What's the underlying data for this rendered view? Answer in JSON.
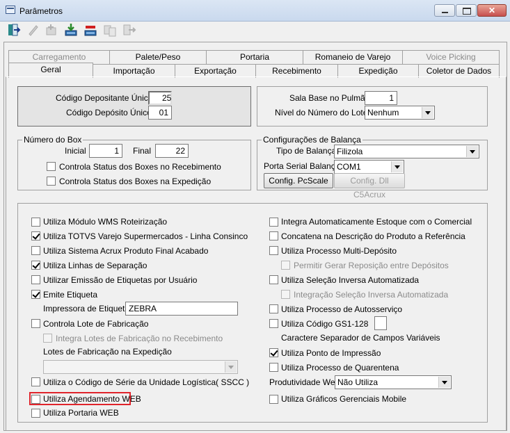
{
  "window": {
    "title": "Parâmetros",
    "close_glyph": "✕"
  },
  "toolbar": {
    "icons": [
      "exit-icon",
      "edit-icon",
      "add-icon",
      "download-icon",
      "delete-icon",
      "copy-icon",
      "export-icon"
    ]
  },
  "tabs": {
    "row1": [
      "Carregamento",
      "Palete/Peso",
      "Portaria",
      "Romaneio de Varejo",
      "Voice Picking"
    ],
    "row2": [
      "Geral",
      "Importação",
      "Exportação",
      "Recebimento",
      "Expedição",
      "Coletor de Dados"
    ]
  },
  "depositante": {
    "codigo_depositante_label": "Código Depositante Único",
    "codigo_depositante_value": "25",
    "codigo_deposito_label": "Código Depósito Único",
    "codigo_deposito_value": "01"
  },
  "sala": {
    "sala_base_label": "Sala Base no Pulmão",
    "sala_base_value": "1",
    "nivel_label": "Nível do Número do Lote",
    "nivel_value": "Nenhum"
  },
  "box": {
    "title": "Número do Box",
    "inicial_label": "Inicial",
    "inicial_value": "1",
    "final_label": "Final",
    "final_value": "22",
    "status_recebimento": "Controla Status dos Boxes no Recebimento",
    "status_expedicao": "Controla Status dos Boxes na Expedição"
  },
  "balanca": {
    "title": "Configurações de Balança",
    "tipo_label": "Tipo de Balança",
    "tipo_value": "Filizola",
    "porta_label": "Porta Serial Balança",
    "porta_value": "COM1",
    "config_pcscale": "Config. PcScale",
    "config_dll": "Config. Dll C5Acrux"
  },
  "left_options": {
    "wms": "Utiliza Módulo WMS Roteirização",
    "totvs": "Utiliza TOTVS Varejo Supermercados - Linha Consinco",
    "acrux": "Utiliza Sistema Acrux Produto Final Acabado",
    "linhas": "Utiliza Linhas de Separação",
    "emissao": "Utilizar Emissão de Etiquetas por Usuário",
    "emite": "Emite Etiqueta",
    "impressora_label": "Impressora de Etiquetas",
    "impressora_value": "ZEBRA",
    "lote_fab": "Controla Lote de Fabricação",
    "integra_lotes": "Integra  Lotes de Fabricação no Recebimento",
    "lotes_exp_label": "Lotes de Fabricação na Expedição",
    "lotes_exp_value": "",
    "sscc": "Utiliza o Código de Série da Unidade Logística( SSCC )",
    "agendamento": "Utiliza Agendamento WEB",
    "portaria": "Utiliza Portaria WEB"
  },
  "right_options": {
    "integra_estoque": "Integra Automaticamente Estoque com o Comercial",
    "concatena": "Concatena na Descrição do Produto a Referência",
    "multi_deposito": "Utiliza Processo Multi-Depósito",
    "permitir_reposicao": "Permitir Gerar Reposição entre Depósitos",
    "selecao_inversa": "Utiliza Seleção Inversa Automatizada",
    "integracao_selecao": "Integração Seleção Inversa Automatizada",
    "autosservico": "Utiliza Processo de Autosserviço",
    "gs1": "Utiliza Código GS1-128",
    "gs1_value": "",
    "separador": "Caractere Separador de Campos Variáveis",
    "ponto_impressao": "Utiliza Ponto de Impressão",
    "quarentena": "Utiliza Processo de Quarentena",
    "produtividade_label": "Produtividade Web",
    "produtividade_value": "Não Utiliza",
    "graficos": "Utiliza Gráficos Gerenciais Mobile"
  }
}
